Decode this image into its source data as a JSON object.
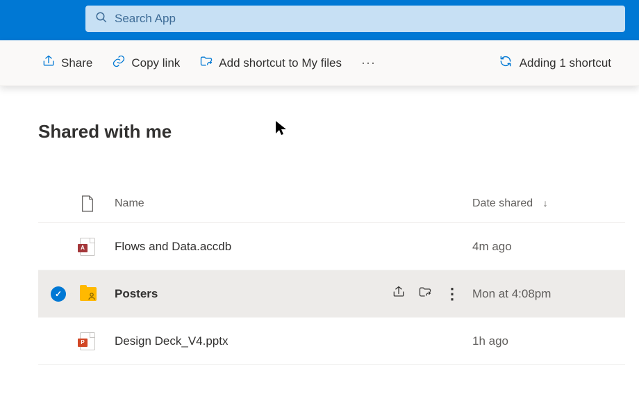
{
  "search": {
    "placeholder": "Search App"
  },
  "commandBar": {
    "share": "Share",
    "copyLink": "Copy link",
    "addShortcut": "Add shortcut to My files",
    "status": "Adding 1 shortcut"
  },
  "page": {
    "title": "Shared with me"
  },
  "columns": {
    "name": "Name",
    "dateShared": "Date shared"
  },
  "files": [
    {
      "name": "Flows and Data.accdb",
      "dateShared": "4m ago",
      "type": "access",
      "selected": false
    },
    {
      "name": "Posters",
      "dateShared": "Mon at 4:08pm",
      "type": "folder",
      "selected": true
    },
    {
      "name": "Design Deck_V4.pptx",
      "dateShared": "1h ago",
      "type": "pptx",
      "selected": false
    }
  ]
}
